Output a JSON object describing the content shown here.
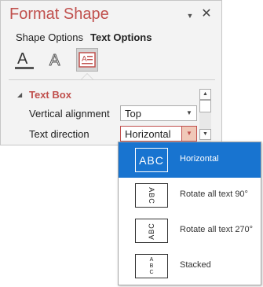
{
  "pane": {
    "title": "Format Shape",
    "pin_glyph": "▼",
    "close_glyph": "✕",
    "tabs": [
      {
        "label": "Shape Options"
      },
      {
        "label": "Text Options"
      }
    ],
    "icon_tabs": [
      {
        "icon": "text-fill-outline-icon",
        "glyph": "A"
      },
      {
        "icon": "text-effects-icon",
        "glyph": "A"
      },
      {
        "icon": "textbox-icon",
        "glyph": "A"
      }
    ]
  },
  "section": {
    "title": "Text Box",
    "expand_glyph": "◢",
    "vertical_alignment": {
      "label": "Vertical alignment",
      "value": "Top"
    },
    "text_direction": {
      "label": "Text direction",
      "value": "Horizontal"
    }
  },
  "dropdown": {
    "options": [
      {
        "label": "Horizontal",
        "preview": "ABC",
        "selected": true
      },
      {
        "label": "Rotate all text 90°",
        "preview": "ABC",
        "selected": false
      },
      {
        "label": "Rotate all text 270°",
        "preview": "ABC",
        "selected": false
      },
      {
        "label": "Stacked",
        "preview": [
          "A",
          "B",
          "C"
        ],
        "selected": false
      }
    ]
  },
  "colors": {
    "accent": "#c0504d",
    "selection": "#1874d0"
  }
}
